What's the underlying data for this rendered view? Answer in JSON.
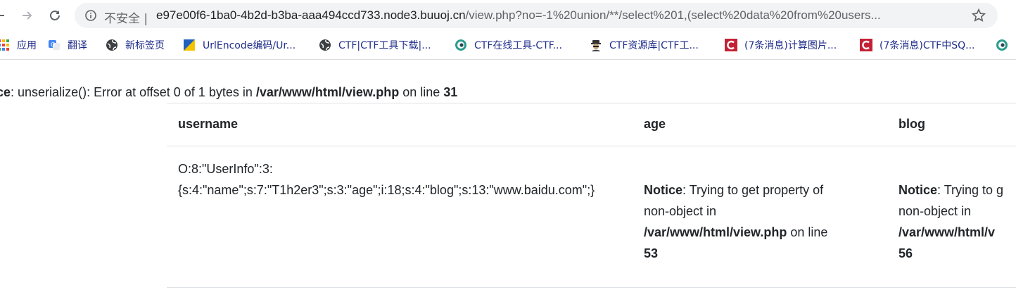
{
  "browser": {
    "security_label": "不安全",
    "url_host": "e97e00f6-1ba0-4b2d-b3ba-aaa494ccd733.node3.buuoj.cn",
    "url_path": "/view.php?no=-1%20union/**/select%201,(select%20data%20from%20users..."
  },
  "bookmarks": [
    {
      "label": "应用",
      "icon": "apps-grid-icon"
    },
    {
      "label": "翻译",
      "icon": "google-translate-icon"
    },
    {
      "label": "新标签页",
      "icon": "globe-icon"
    },
    {
      "label": "UrlEncode编码/Ur...",
      "icon": "urlencode-logo-icon"
    },
    {
      "label": "CTF|CTF工具下载|...",
      "icon": "globe-icon"
    },
    {
      "label": "CTF在线工具-CTF...",
      "icon": "ctf-tool-icon"
    },
    {
      "label": "CTF资源库|CTF工...",
      "icon": "spy-icon"
    },
    {
      "label": "(7条消息)计算图片...",
      "icon": "csdn-icon"
    },
    {
      "label": "(7条消息)CTF中SQ...",
      "icon": "csdn-icon"
    }
  ],
  "page": {
    "notice_top": {
      "label": "tice",
      "message": ": unserialize(): Error at offset 0 of 1 bytes in ",
      "path": "/var/www/html/view.php",
      "on_line": " on line ",
      "line": "31"
    },
    "table": {
      "headers": [
        "username",
        "age",
        "blog"
      ],
      "username_line1": "O:8:\"UserInfo\":3:",
      "username_line2": "{s:4:\"name\";s:7:\"T1h2er3\";s:3:\"age\";i:18;s:4:\"blog\";s:13:\"www.baidu.com\";}",
      "age_notice": {
        "label": "Notice",
        "message1": ": Trying to get property of",
        "message2": "non-object in",
        "path": "/var/www/html/view.php",
        "on_line": " on line",
        "line": "53"
      },
      "blog_notice": {
        "label": "Notice",
        "message1": ": Trying to g",
        "message2": "non-object in",
        "path": "/var/www/html/v",
        "line": "56"
      }
    }
  }
}
